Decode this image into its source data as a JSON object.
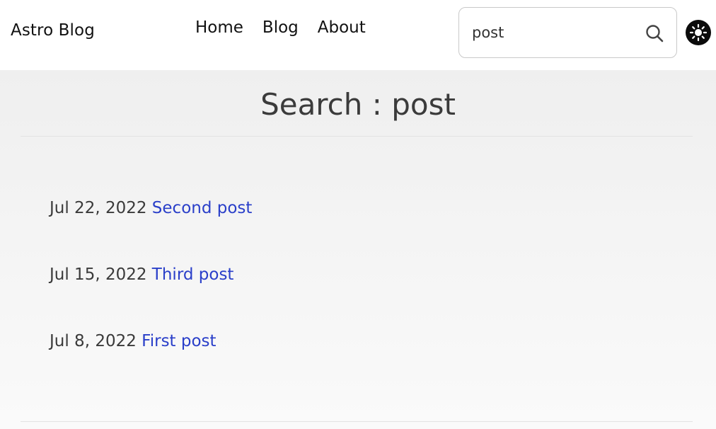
{
  "header": {
    "brand": "Astro Blog",
    "nav": [
      "Home",
      "Blog",
      "About"
    ],
    "search": {
      "value": "post",
      "icon": "search-icon"
    },
    "theme_toggle": {
      "icon": "sun-icon"
    }
  },
  "main": {
    "title": "Search : post",
    "results": [
      {
        "date": "Jul 22, 2022",
        "title": "Second post"
      },
      {
        "date": "Jul 15, 2022",
        "title": "Third post"
      },
      {
        "date": "Jul 8, 2022",
        "title": "First post"
      }
    ]
  },
  "colors": {
    "link": "#2a3fc9",
    "text": "#3a3a3a",
    "toggle_bg": "#0b0b0b"
  }
}
